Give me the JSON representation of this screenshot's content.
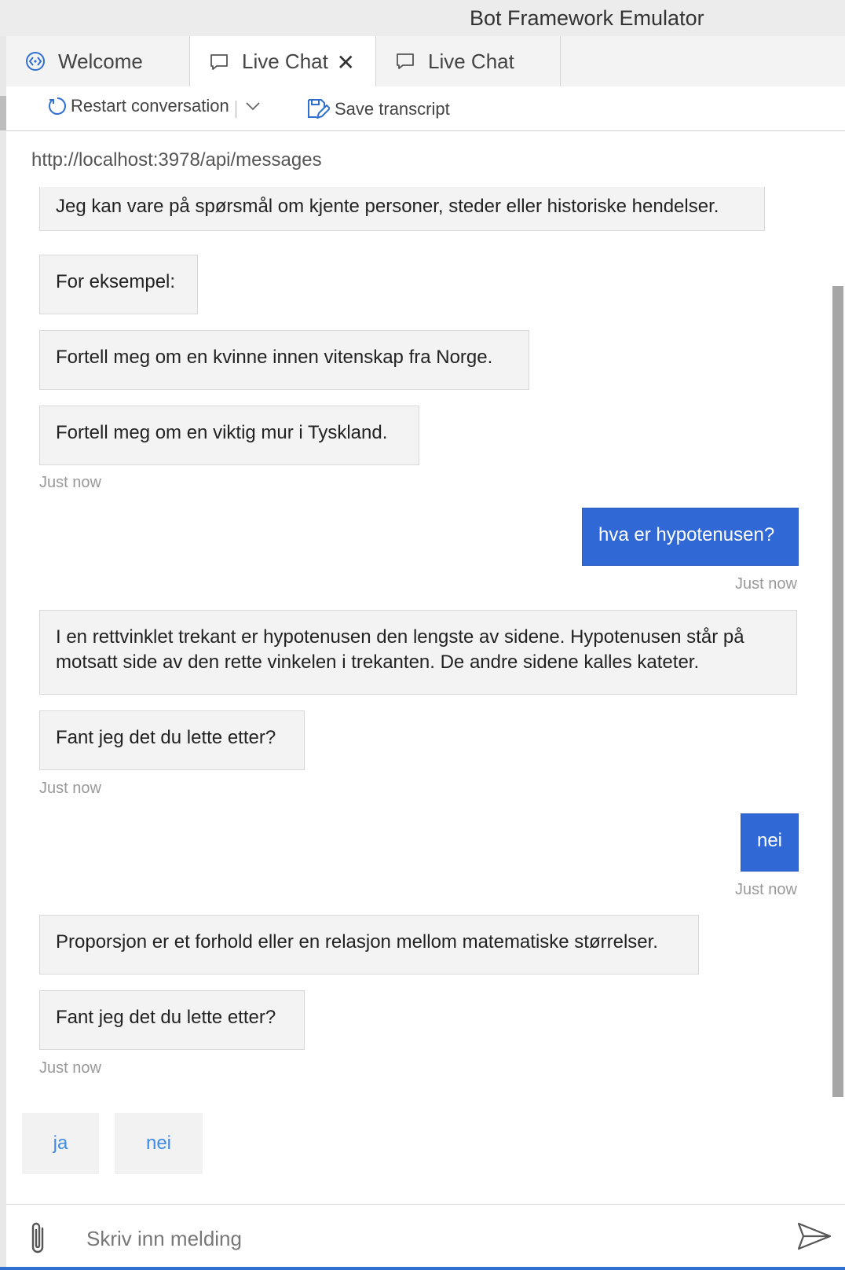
{
  "window": {
    "title": "Bot Framework Emulator"
  },
  "tabs": [
    {
      "label": "Welcome",
      "icon": "welcome-icon",
      "active": false
    },
    {
      "label": "Live Chat",
      "icon": "chat-bubble-icon",
      "active": true,
      "closable": true
    },
    {
      "label": "Live Chat",
      "icon": "chat-bubble-icon",
      "active": false
    }
  ],
  "toolbar": {
    "restart_label": "Restart conversation",
    "save_label": "Save transcript"
  },
  "endpoint": "http://localhost:3978/api/messages",
  "messages": [
    {
      "from": "bot",
      "text": "Jeg kan vare på spørsmål om kjente personer, steder eller historiske hendelser."
    },
    {
      "from": "bot",
      "text": "For eksempel:"
    },
    {
      "from": "bot",
      "text": "Fortell meg om en kvinne innen vitenskap fra Norge."
    },
    {
      "from": "bot",
      "text": "Fortell meg om en viktig mur i Tyskland."
    },
    {
      "from": "bot_timestamp",
      "text": "Just now"
    },
    {
      "from": "user",
      "text": "hva er hypotenusen?"
    },
    {
      "from": "user_timestamp",
      "text": "Just now"
    },
    {
      "from": "bot",
      "text": "I en rettvinklet trekant er hypotenusen den lengste av sidene. Hypotenusen står på motsatt side av den rette vinkelen i trekanten. De andre sidene kalles kateter."
    },
    {
      "from": "bot",
      "text": "Fant jeg det du lette etter?"
    },
    {
      "from": "bot_timestamp",
      "text": "Just now"
    },
    {
      "from": "user",
      "text": "nei"
    },
    {
      "from": "user_timestamp",
      "text": "Just now"
    },
    {
      "from": "bot",
      "text": "Proporsjon er et forhold eller en relasjon mellom matematiske størrelser."
    },
    {
      "from": "bot",
      "text": "Fant jeg det du lette etter?"
    },
    {
      "from": "bot_timestamp",
      "text": "Just now"
    }
  ],
  "suggested_actions": [
    "ja",
    "nei"
  ],
  "input": {
    "placeholder": "Skriv inn melding",
    "value": ""
  },
  "colors": {
    "user_bubble": "#3068d6",
    "bot_bubble": "#f3f3f3",
    "action_text": "#3f8ce6",
    "accent": "#2f6fd0"
  }
}
